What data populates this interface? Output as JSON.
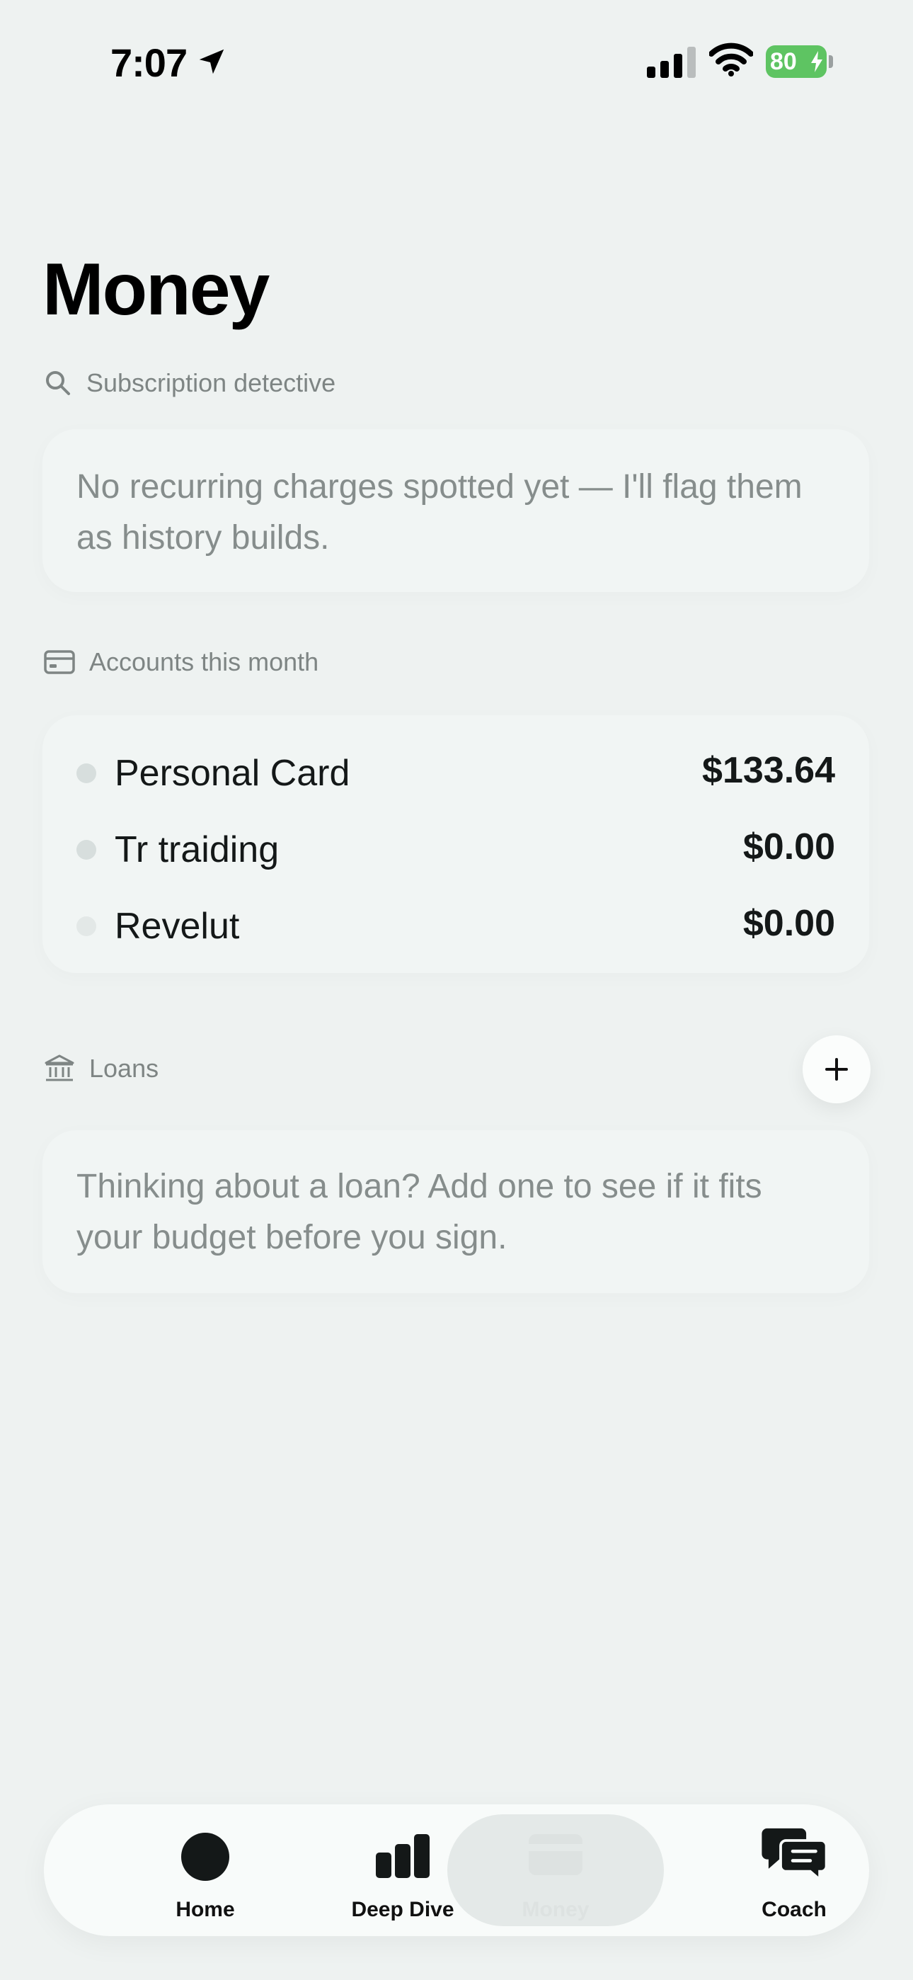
{
  "status_bar": {
    "time": "7:07",
    "battery_level": "80",
    "battery_color": "#5ec462"
  },
  "page": {
    "title": "Money"
  },
  "subscription_section": {
    "header": "Subscription detective",
    "icon": "search-icon",
    "empty_message": "No recurring charges spotted yet — I'll flag them as history builds."
  },
  "accounts_section": {
    "header": "Accounts this month",
    "icon": "credit-card-icon",
    "accounts": [
      {
        "name": "Personal Card",
        "amount": "$133.64",
        "dot_color": "#d7dedd"
      },
      {
        "name": "Tr traiding",
        "amount": "$0.00",
        "dot_color": "#d7dedd"
      },
      {
        "name": "Revelut",
        "amount": "$0.00",
        "dot_color": "#e3e8e7"
      }
    ]
  },
  "loans_section": {
    "header": "Loans",
    "icon": "bank-icon",
    "add_icon": "plus-icon",
    "empty_message": "Thinking about a loan? Add one to see if it fits your budget before you sign."
  },
  "tab_bar": {
    "tabs": [
      {
        "label": "Home",
        "icon": "home-circle-icon",
        "selected": false
      },
      {
        "label": "Deep Dive",
        "icon": "bar-chart-icon",
        "selected": false
      },
      {
        "label": "Money",
        "icon": "wallet-icon",
        "selected": true
      },
      {
        "label": "Coach",
        "icon": "chat-bubbles-icon",
        "selected": false
      }
    ]
  }
}
